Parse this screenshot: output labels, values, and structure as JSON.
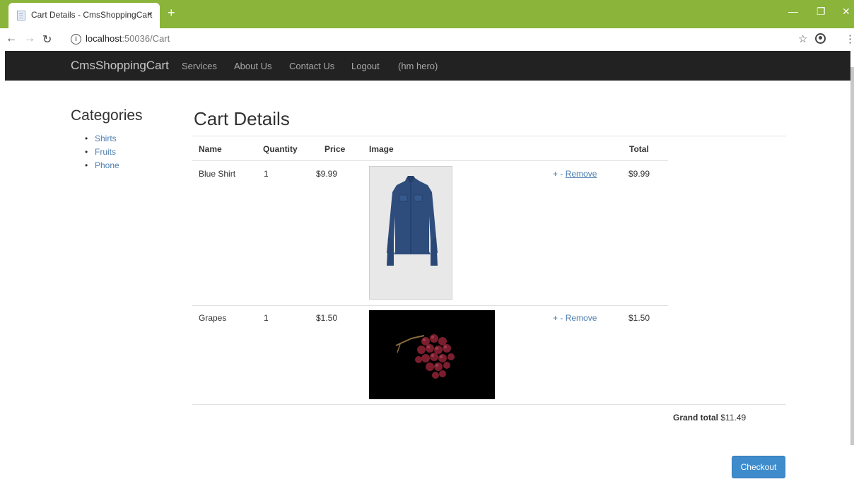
{
  "browser": {
    "tab_title": "Cart Details - CmsShoppingCart",
    "tab_close": "×",
    "new_tab": "+",
    "url_host": "localhost",
    "url_path": ":50036/Cart",
    "info_icon": "i"
  },
  "navbar": {
    "brand": "CmsShoppingCart",
    "links": [
      "Services",
      "About Us",
      "Contact Us",
      "Logout",
      "(hm hero)"
    ]
  },
  "sidebar": {
    "title": "Categories",
    "items": [
      "Shirts",
      "Fruits",
      "Phone"
    ]
  },
  "main": {
    "title": "Cart Details",
    "columns": [
      "Name",
      "Quantity",
      "Price",
      "Image",
      "Total"
    ],
    "rows": [
      {
        "name": "Blue Shirt",
        "quantity": "1",
        "price": "$9.99",
        "plus": "+",
        "minus": "-",
        "remove": "Remove",
        "total": "$9.99",
        "image": "blue-shirt-image"
      },
      {
        "name": "Grapes",
        "quantity": "1",
        "price": "$1.50",
        "plus": "+",
        "minus": "-",
        "remove": "Remove",
        "total": "$1.50",
        "image": "grapes-image"
      }
    ],
    "grand_total_label": "Grand total",
    "grand_total_value": "$11.49",
    "checkout_label": "Checkout"
  },
  "colors": {
    "tabbar": "#8ab43a",
    "navbar": "#222222",
    "link": "#4e7fb1",
    "checkout": "#3f8ccc"
  }
}
